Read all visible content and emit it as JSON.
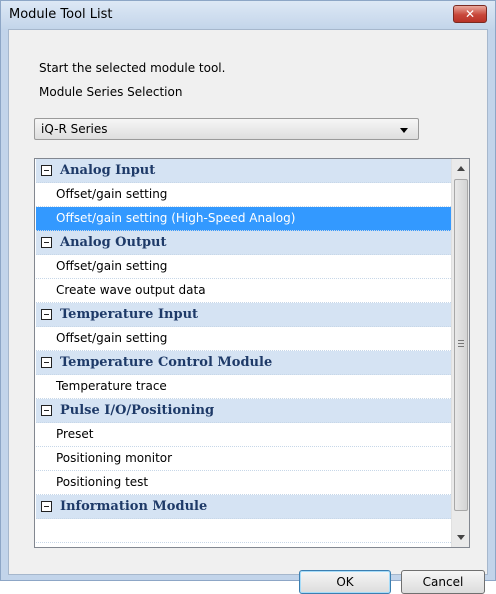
{
  "window": {
    "title": "Module Tool List",
    "close_label": "✕"
  },
  "content": {
    "instruction": "Start the selected module tool.",
    "series_label": "Module Series Selection"
  },
  "series_select": {
    "selected": "iQ-R Series"
  },
  "tool_list": {
    "groups": [
      {
        "label": "Analog Input",
        "items": [
          "Offset/gain setting",
          "Offset/gain setting (High-Speed Analog)"
        ]
      },
      {
        "label": "Analog Output",
        "items": [
          "Offset/gain setting",
          "Create wave output data"
        ]
      },
      {
        "label": "Temperature Input",
        "items": [
          "Offset/gain setting"
        ]
      },
      {
        "label": "Temperature Control Module",
        "items": [
          "Temperature trace"
        ]
      },
      {
        "label": "Pulse I/O/Positioning",
        "items": [
          "Preset",
          "Positioning monitor",
          "Positioning test"
        ]
      },
      {
        "label": "Information Module",
        "items": []
      }
    ],
    "selected_item": "Offset/gain setting (High-Speed Analog)"
  },
  "buttons": {
    "ok": "OK",
    "cancel": "Cancel"
  },
  "colors": {
    "group_background": "#d5e3f3",
    "group_text": "#1e3a68",
    "selection": "#3399ff"
  }
}
